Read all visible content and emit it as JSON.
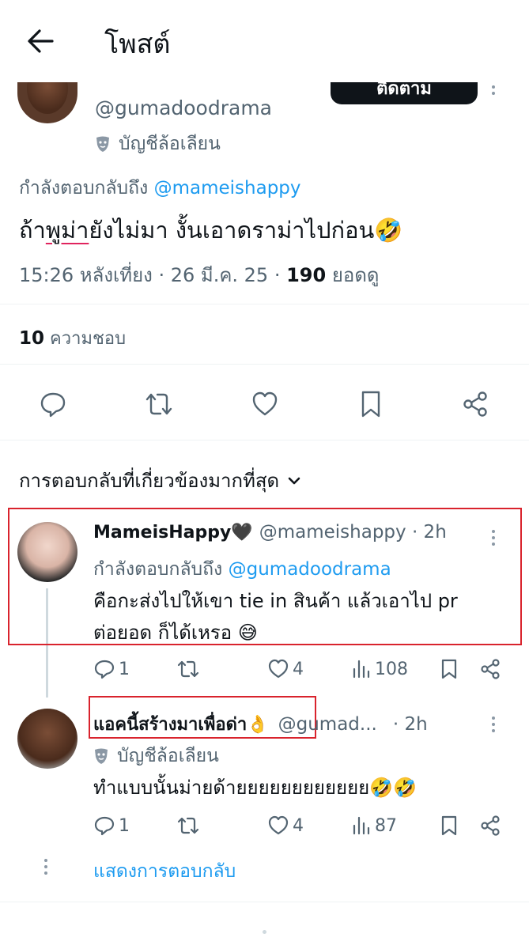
{
  "header": {
    "title": "โพสต์"
  },
  "main_tweet": {
    "author_handle": "@gumadoodrama",
    "author_label": "บัญชีล้อเลียน",
    "follow_label": "ติดตาม",
    "replying_prefix": "กำลังตอบกลับถึง",
    "replying_to": "@mameishappy",
    "text_a": "ถ้า",
    "text_b": "พูม่า",
    "text_c": "ยังไม่มา งั้นเอาดราม่าไปก่อน🤣",
    "time": "15:26 หลังเที่ยง · 26 มี.ค. 25 ·",
    "views": "190",
    "views_label": "ยอดดู",
    "likes_count": "10",
    "likes_label": "ความชอบ"
  },
  "section": {
    "relevant_label": "การตอบกลับที่เกี่ยวข้องมากที่สุด"
  },
  "replies": [
    {
      "name": "MameisHappy🖤",
      "handle": "@mameishappy · 2h",
      "replying_prefix": "กำลังตอบกลับถึง",
      "replying_to": "@gumadoodrama",
      "text_line1": "คือกะส่งไปให้เขา tie in สินค้า แล้วเอาไป pr",
      "text_line2": "ต่อยอด ก็ได้เหรอ 😅",
      "reply_count": "1",
      "like_count": "4",
      "view_count": "108"
    },
    {
      "name": "แอคนี้สร้างมาเพื่อด่า👌",
      "handle": "@gumad...",
      "time": "· 2h",
      "label": "บัญชีล้อเลียน",
      "text_line1": "ทำแบบนั้นม่ายด้ายยยยยยยยยยยย🤣🤣",
      "reply_count": "1",
      "like_count": "4",
      "view_count": "87"
    }
  ],
  "show_replies_label": "แสดงการตอบกลับ",
  "colors": {
    "accent": "#1d9bf0",
    "muted": "#536471",
    "highlight": "#d9232d",
    "text": "#0f1419"
  }
}
